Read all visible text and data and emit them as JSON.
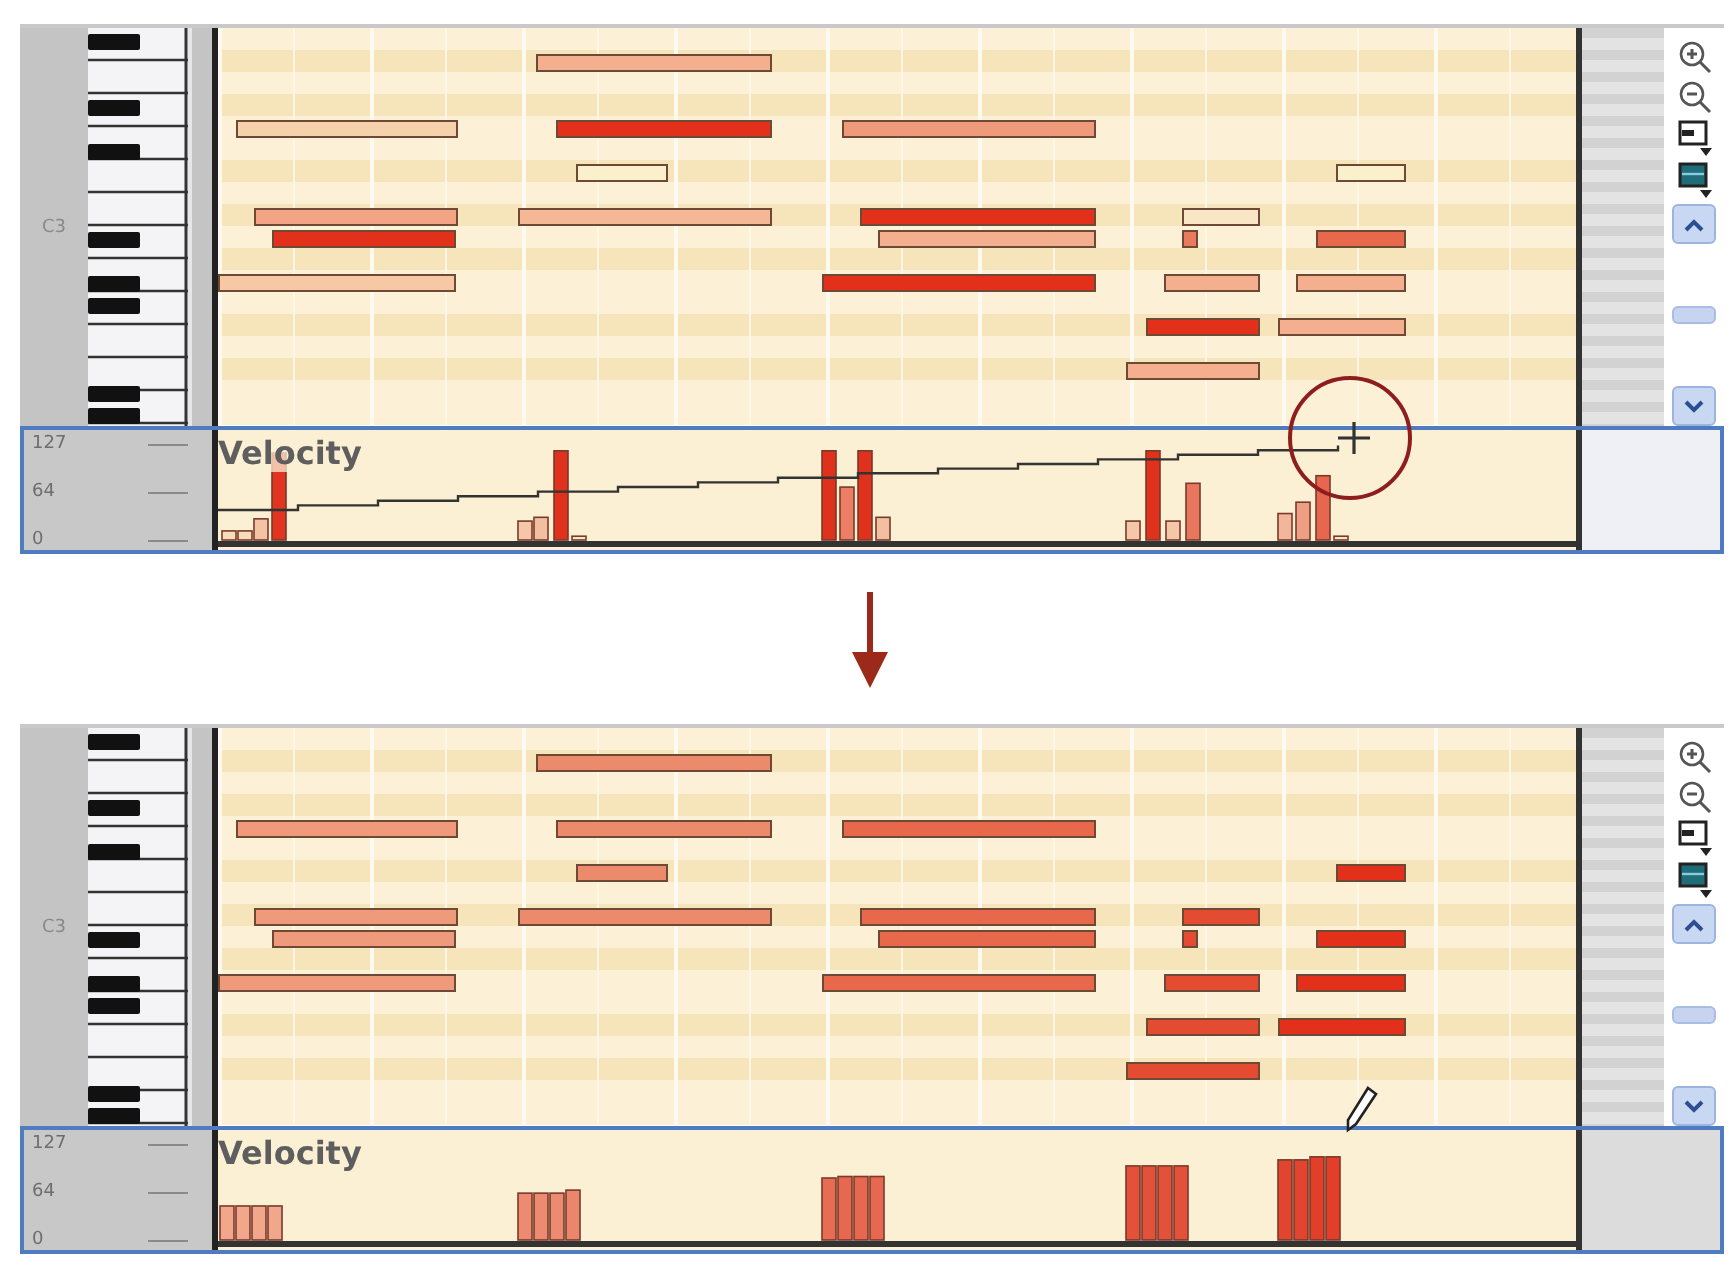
{
  "panels": [
    {
      "key_label": "C3",
      "notes": [
        {
          "color": "#f4b08e"
        },
        {
          "color": "#f6d2ac"
        },
        {
          "color": "#e2301a"
        },
        {
          "color": "#f09a7c"
        },
        {
          "color": "#faf0cc"
        },
        {
          "color": "#faf0cc"
        },
        {
          "color": "#f2a484"
        },
        {
          "color": "#f4b896"
        },
        {
          "color": "#e2301a"
        },
        {
          "color": "#f8e6c4"
        },
        {
          "color": "#e2301a"
        },
        {
          "color": "#f4b08e"
        },
        {
          "color": "#ea7a5e"
        },
        {
          "color": "#e8684c"
        },
        {
          "color": "#f6c8a4"
        },
        {
          "color": "#e2301a"
        },
        {
          "color": "#f4b08e"
        },
        {
          "color": "#f4b08e"
        },
        {
          "color": "#e2301a"
        },
        {
          "color": "#f4b08e"
        },
        {
          "color": "#f4b08e"
        }
      ],
      "velocity_lane": {
        "title": "Velocity",
        "ramp_line": true,
        "cursor": {
          "kind": "crosshair"
        },
        "scale_labels": [
          "127",
          "64",
          "0"
        ]
      }
    },
    {
      "key_label": "C3",
      "notes": [
        {
          "color": "#ec8a6c"
        },
        {
          "color": "#f09a7c"
        },
        {
          "color": "#ec8a6c"
        },
        {
          "color": "#e8684c"
        },
        {
          "color": "#ec8a6c"
        },
        {
          "color": "#e2301a"
        },
        {
          "color": "#f09a7c"
        },
        {
          "color": "#ec8a6c"
        },
        {
          "color": "#e8684c"
        },
        {
          "color": "#e44c32"
        },
        {
          "color": "#f09a7c"
        },
        {
          "color": "#e8684c"
        },
        {
          "color": "#e44c32"
        },
        {
          "color": "#e2301a"
        },
        {
          "color": "#f09a7c"
        },
        {
          "color": "#e8684c"
        },
        {
          "color": "#e44c32"
        },
        {
          "color": "#e2301a"
        },
        {
          "color": "#e44c32"
        },
        {
          "color": "#e2301a"
        },
        {
          "color": "#e44c32"
        }
      ],
      "velocity_lane": {
        "title": "Velocity",
        "ramp_line": false,
        "cursor": {
          "kind": "pencil"
        },
        "scale_labels": [
          "127",
          "64",
          "0"
        ]
      }
    }
  ]
}
